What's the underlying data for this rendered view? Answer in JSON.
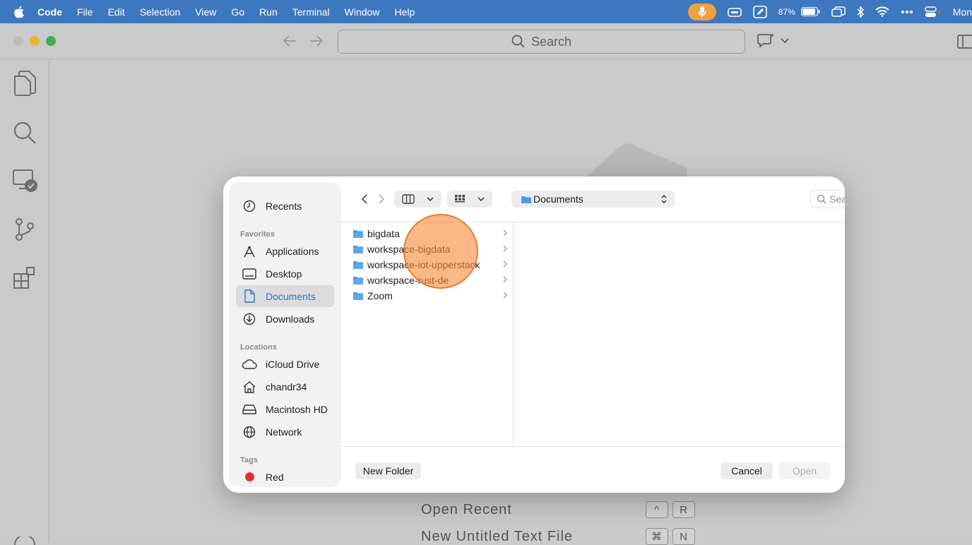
{
  "menubar": {
    "app_name": "Code",
    "items": [
      "File",
      "Edit",
      "Selection",
      "View",
      "Go",
      "Run",
      "Terminal",
      "Window",
      "Help"
    ],
    "battery_percent": "87%",
    "clock": "Mon"
  },
  "titlebar": {
    "search_placeholder": "Search"
  },
  "welcome": {
    "rows": [
      {
        "label": "Open Recent",
        "keys": [
          "^",
          "R"
        ]
      },
      {
        "label": "New Untitled Text File",
        "keys": [
          "⌘",
          "N"
        ]
      }
    ]
  },
  "dialog": {
    "sidebar": {
      "recents": "Recents",
      "favorites_header": "Favorites",
      "favorites": [
        "Applications",
        "Desktop",
        "Documents",
        "Downloads"
      ],
      "selected": "Documents",
      "locations_header": "Locations",
      "locations": [
        "iCloud Drive",
        "chandr34",
        "Macintosh HD",
        "Network"
      ],
      "tags_header": "Tags",
      "tags": [
        {
          "name": "Red",
          "color": "#e03131"
        }
      ]
    },
    "location": "Documents",
    "search_placeholder": "Search",
    "folders": [
      "bigdata",
      "workspace-bigdata",
      "workspace-iot-upperstack",
      "workspace-rust-de",
      "Zoom"
    ],
    "buttons": {
      "new_folder": "New Folder",
      "cancel": "Cancel",
      "open": "Open"
    }
  },
  "colors": {
    "menubar": "#3d77bf",
    "accent": "#2f6fd7",
    "cursor_halo": "#f58c3c"
  }
}
